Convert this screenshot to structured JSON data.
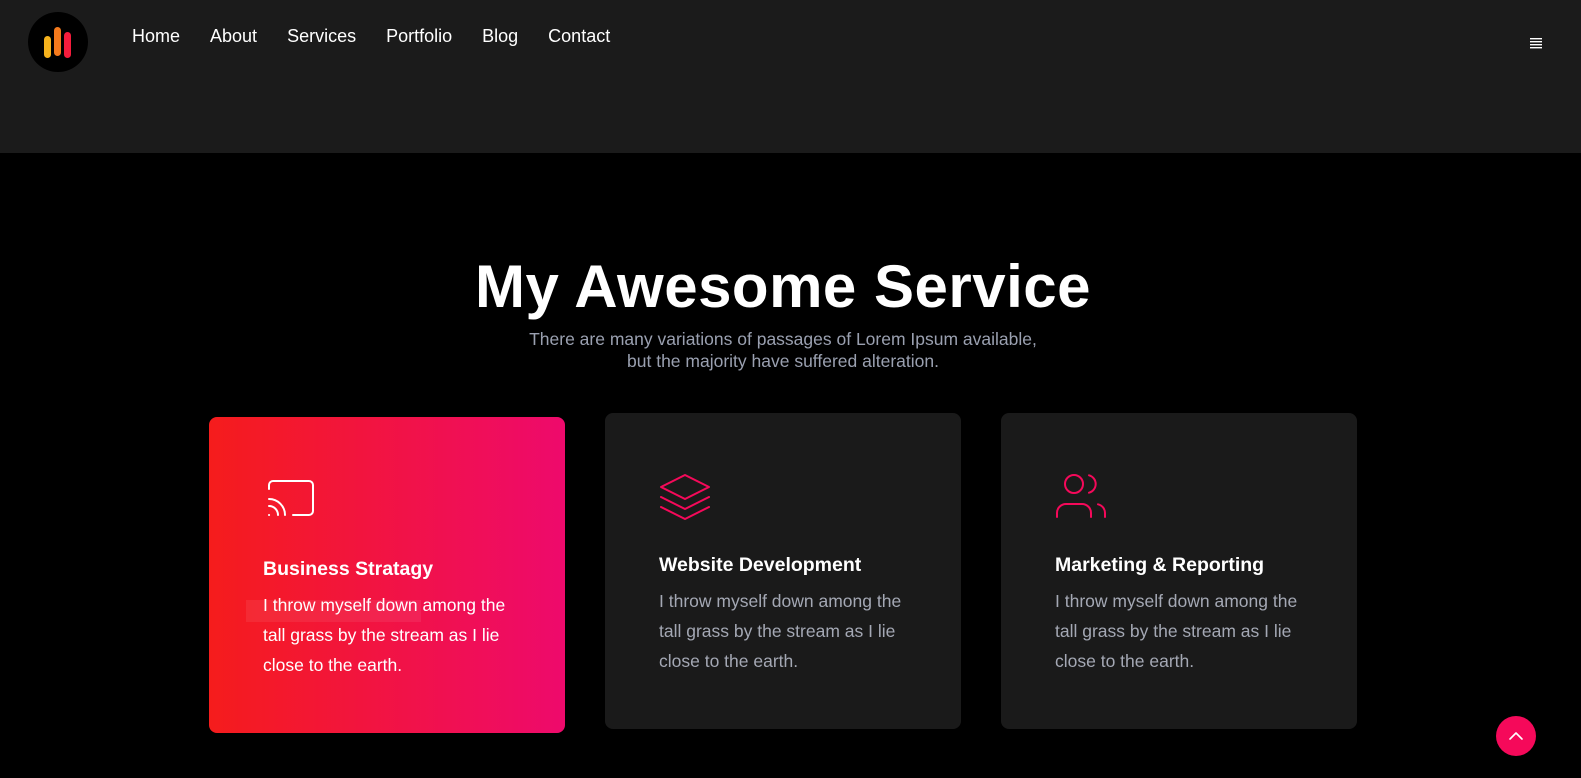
{
  "nav": {
    "items": [
      {
        "label": "Home"
      },
      {
        "label": "About"
      },
      {
        "label": "Services"
      },
      {
        "label": "Portfolio"
      },
      {
        "label": "Blog"
      },
      {
        "label": "Contact"
      }
    ],
    "menu_icon": "hamburger-icon"
  },
  "logo": {
    "icon": "bars-logo-icon",
    "colors": [
      "#f5b21c",
      "#f51c3c"
    ]
  },
  "section": {
    "title": "My Awesome Service",
    "subtitle_line1": "There are many variations of passages of Lorem Ipsum available,",
    "subtitle_line2": "but the majority have suffered alteration."
  },
  "cards": [
    {
      "title": "Business Stratagy",
      "text": "I throw myself down among the tall grass by the stream as I lie close to the earth.",
      "icon": "cast-icon",
      "active": true
    },
    {
      "title": "Website Development",
      "text": "I throw myself down among the tall grass by the stream as I lie close to the earth.",
      "icon": "layers-icon",
      "active": false
    },
    {
      "title": "Marketing & Reporting",
      "text": "I throw myself down among the tall grass by the stream as I lie close to the earth.",
      "icon": "users-icon",
      "active": false
    }
  ],
  "colors": {
    "accent": "#f5095a",
    "gradient_start": "#f51c1c",
    "gradient_end": "#ee0a6c",
    "header_bg": "#1b1b1b",
    "card_bg": "#1a1a1a"
  },
  "back_to_top": {
    "icon": "chevron-up-icon"
  }
}
